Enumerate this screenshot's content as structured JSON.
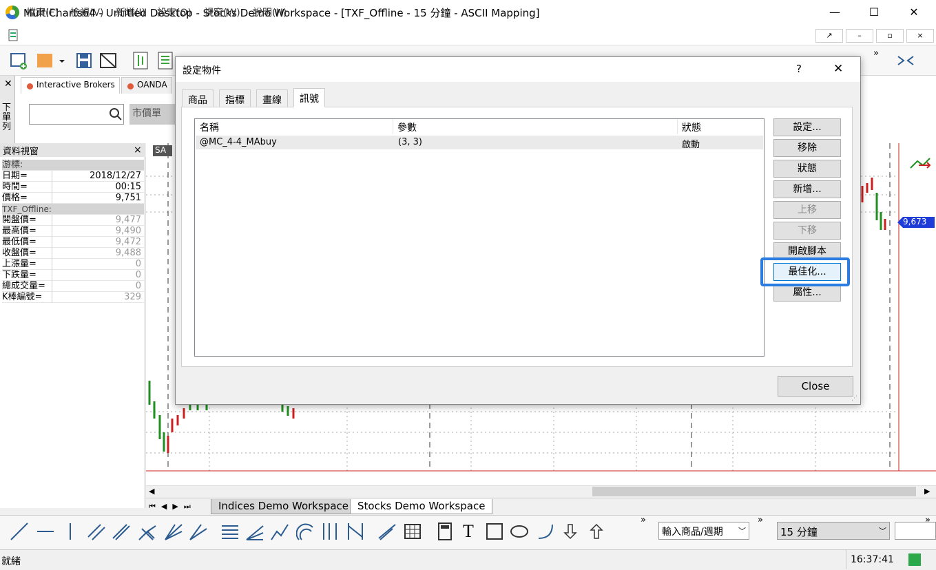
{
  "window": {
    "title": "MultiCharts64 - Untitled Desktop - Stocks Demo Workspace - [TXF_Offline - 15 分鐘 - ASCII Mapping]",
    "min_glyph": "—",
    "max_glyph": "☐",
    "close_glyph": "✕"
  },
  "menu": {
    "items": [
      "檔案(F)",
      "檢視(V)",
      "新增(I)",
      "設定(O)",
      "視窗(W)",
      "說明(H)"
    ]
  },
  "broker_tabs": [
    "Interactive Brokers",
    "OANDA"
  ],
  "order_bar": {
    "market_label": "市價單",
    "side_label": "下單列"
  },
  "data_view": {
    "title": "資料視窗",
    "close_glyph": "×",
    "cursor_header": "游標:",
    "rows_cursor": [
      {
        "label": "日期=",
        "value": "2018/12/27"
      },
      {
        "label": "時間=",
        "value": "00:15"
      },
      {
        "label": "價格=",
        "value": "9,751"
      }
    ],
    "symbol_header": "TXF_Offline:",
    "rows_symbol": [
      {
        "label": "開盤價=",
        "value": "9,477"
      },
      {
        "label": "最高價=",
        "value": "9,490"
      },
      {
        "label": "最低價=",
        "value": "9,472"
      },
      {
        "label": "收盤價=",
        "value": "9,488"
      },
      {
        "label": "上漲量=",
        "value": "0"
      },
      {
        "label": "下跌量=",
        "value": "0"
      },
      {
        "label": "總成交量=",
        "value": "0"
      },
      {
        "label": "K棒編號=",
        "value": "329"
      }
    ]
  },
  "chart": {
    "sa_label": "SA",
    "price_label": "9,673",
    "colors": {
      "up": "#cc1f1f",
      "down": "#1f8f1f",
      "price_tag": "#1e3cd8"
    }
  },
  "workspace_tabs": [
    "Indices Demo Workspace",
    "Stocks Demo Workspace"
  ],
  "active_workspace": "Stocks Demo Workspace",
  "draw_bar": {
    "symbol_input": "輸入商品/週期",
    "resolution": "15 分鐘"
  },
  "status": {
    "text": "就緒",
    "time": "16:37:41"
  },
  "dialog": {
    "title": "設定物件",
    "help_glyph": "?",
    "close_glyph": "✕",
    "tabs": [
      "商品",
      "指標",
      "畫線",
      "訊號"
    ],
    "active_tab": "訊號",
    "columns": [
      "名稱",
      "參數",
      "狀態"
    ],
    "rows": [
      {
        "name": "@MC_4-4_MAbuy",
        "params": "(3, 3)",
        "status": "啟動"
      }
    ],
    "buttons": {
      "settings": "設定...",
      "remove": "移除",
      "status": "狀態",
      "add": "新增...",
      "move_up": "上移",
      "move_down": "下移",
      "open_script": "開啟腳本",
      "optimize": "最佳化...",
      "properties": "屬性..."
    },
    "close_label": "Close",
    "highlight_color": "#2b7de2"
  }
}
